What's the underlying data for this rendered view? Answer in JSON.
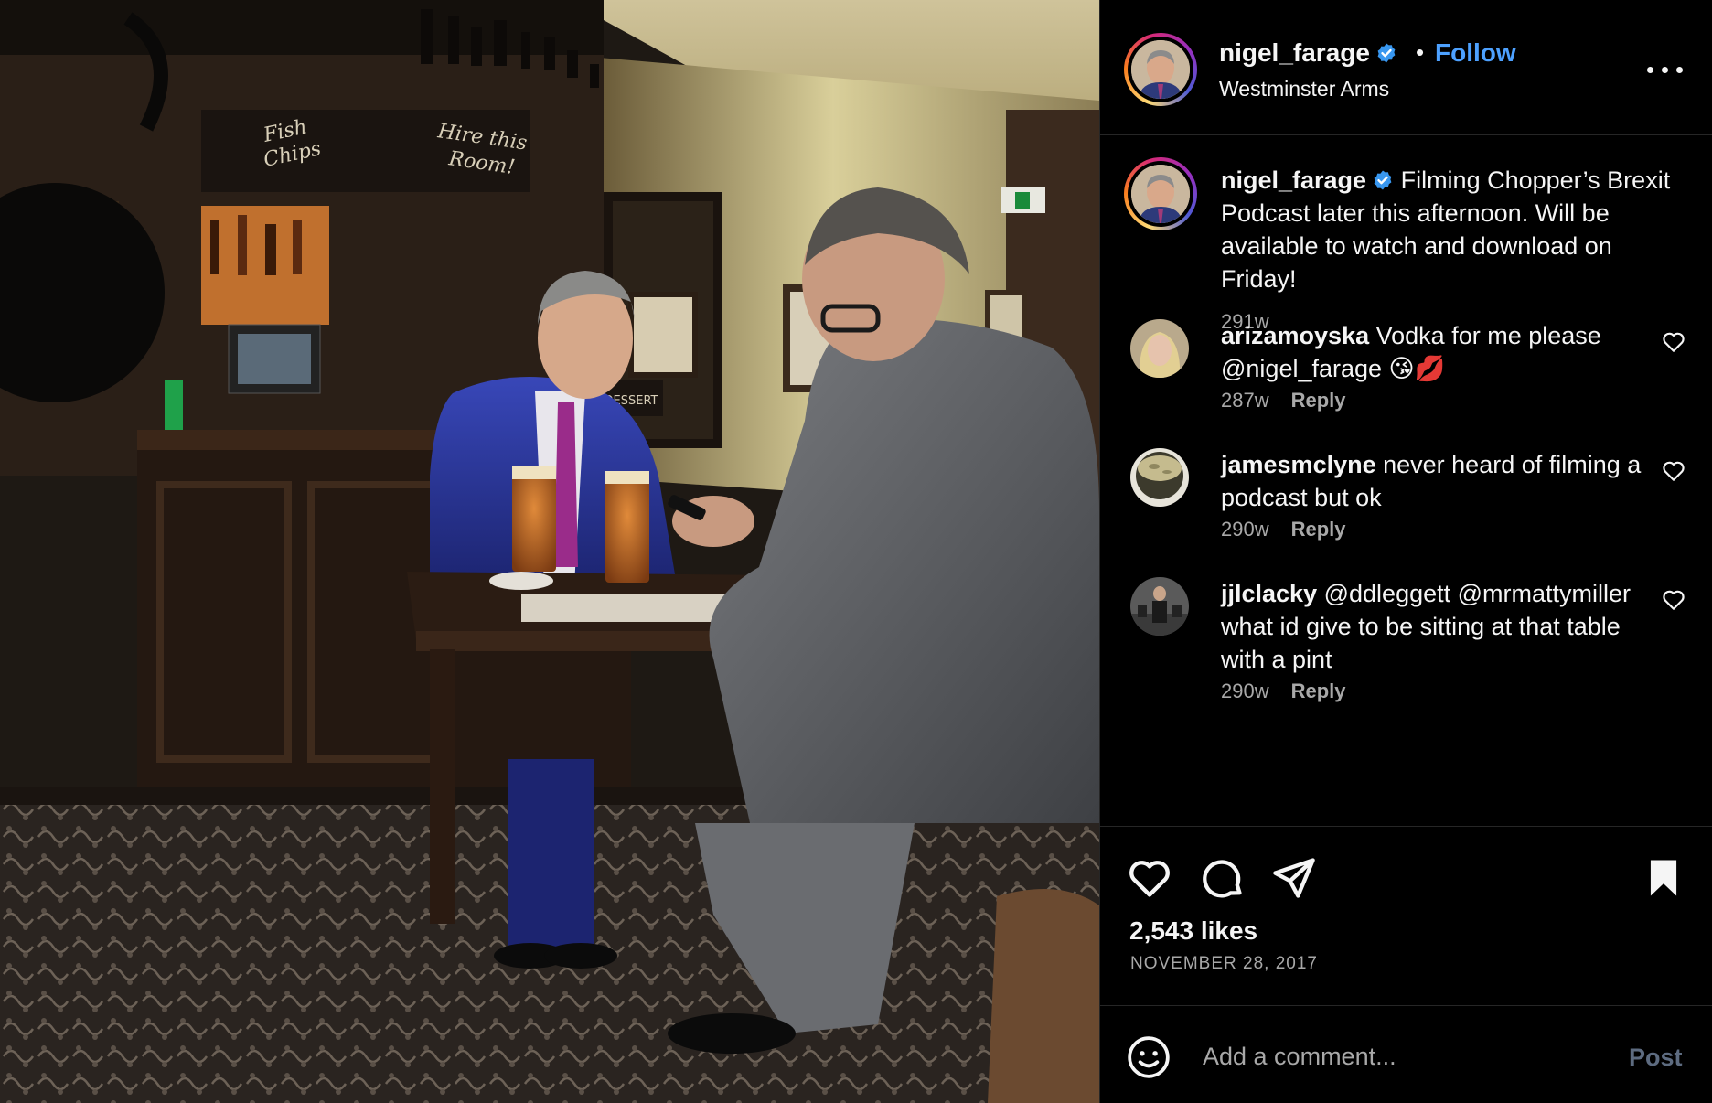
{
  "post": {
    "author": {
      "username": "nigel_farage",
      "verified": true,
      "avatar": "avatar-nigel-farage"
    },
    "location": "Westminster Arms",
    "follow_label": "Follow",
    "separator": "•",
    "more_icon": "more-horizontal-icon",
    "photo": {
      "description_icon": "photo-two-men-at-pub-table",
      "signs": [
        "Fish and Chips",
        "Hire this Room!",
        "DESSERT"
      ]
    }
  },
  "caption": {
    "username": "nigel_farage",
    "text": "Filming Chopper’s Brexit Podcast later this afternoon. Will be available to watch and download on Friday!",
    "age": "291w"
  },
  "comments": [
    {
      "username": "arizamoyska",
      "text": "Vodka for me please @nigel_farage 😘💋",
      "age": "287w",
      "reply_label": "Reply",
      "avatar": "avatar-arizamoyska"
    },
    {
      "username": "jamesmclyne",
      "text": "never heard of filming a podcast but ok",
      "age": "290w",
      "reply_label": "Reply",
      "avatar": "avatar-jamesmclyne"
    },
    {
      "username": "jjlclacky",
      "text": "@ddleggett @mrmattymiller what id give to be sitting at that table with a pint",
      "age": "290w",
      "reply_label": "Reply",
      "avatar": "avatar-jjlclacky"
    }
  ],
  "actions": {
    "icons": [
      "heart-icon",
      "comment-icon",
      "share-icon",
      "bookmark-icon"
    ],
    "likes": "2,543 likes",
    "date": "NOVEMBER 28, 2017"
  },
  "composer": {
    "placeholder": "Add a comment...",
    "post_label": "Post",
    "emoji_icon": "emoji-icon"
  },
  "colors": {
    "background": "#000000",
    "text": "#f5f5f5",
    "secondary_text": "#a8a8a8",
    "link_blue": "#4da1ff",
    "verified_blue": "#3897f0",
    "divider": "#262626",
    "post_button_disabled": "#5d6b80"
  }
}
